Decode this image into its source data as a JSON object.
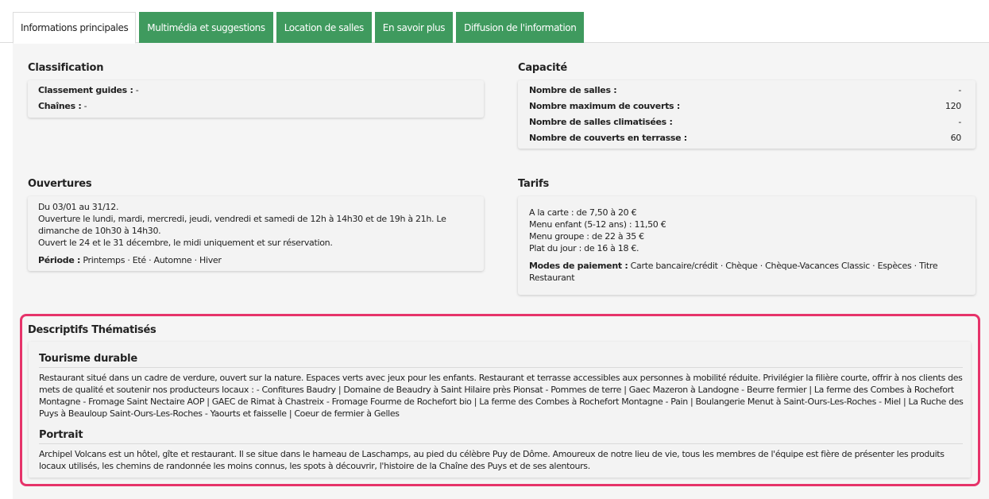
{
  "tabs": [
    {
      "label": "Informations principales",
      "active": true
    },
    {
      "label": "Multimédia et suggestions",
      "active": false
    },
    {
      "label": "Location de salles",
      "active": false
    },
    {
      "label": "En savoir plus",
      "active": false
    },
    {
      "label": "Diffusion de l'information",
      "active": false
    }
  ],
  "classification": {
    "title": "Classification",
    "rows": [
      {
        "label": "Classement guides :",
        "value": "-"
      },
      {
        "label": "Chaînes :",
        "value": "-"
      }
    ]
  },
  "capacite": {
    "title": "Capacité",
    "rows": [
      {
        "label": "Nombre de salles :",
        "value": "-"
      },
      {
        "label": "Nombre maximum de couverts :",
        "value": "120"
      },
      {
        "label": "Nombre de salles climatisées :",
        "value": "-"
      },
      {
        "label": "Nombre de couverts en terrasse :",
        "value": "60"
      }
    ]
  },
  "ouvertures": {
    "title": "Ouvertures",
    "lines": [
      "Du 03/01 au 31/12.",
      "Ouverture le lundi, mardi, mercredi, jeudi, vendredi et samedi de 12h à 14h30 et de 19h à 21h. Le dimanche de 10h30 à 14h30.",
      "Ouvert le 24 et le 31 décembre, le midi uniquement et sur réservation."
    ],
    "periode_label": "Période :",
    "periode": [
      "Printemps",
      "Eté",
      "Automne",
      "Hiver"
    ]
  },
  "tarifs": {
    "title": "Tarifs",
    "lines": [
      "A la carte : de 7,50 à 20 €",
      "Menu enfant (5-12 ans) : 11,50 €",
      "Menu groupe : de 22 à 35 €",
      "Plat du jour : de 16 à 18 €."
    ],
    "paiement_label": "Modes de paiement :",
    "paiement": [
      "Carte bancaire/crédit",
      "Chèque",
      "Chèque-Vacances Classic",
      "Espèces",
      "Titre Restaurant"
    ]
  },
  "descriptifs": {
    "title": "Descriptifs Thématisés",
    "sections": [
      {
        "title": "Tourisme durable",
        "text": "Restaurant situé dans un cadre de verdure, ouvert sur la nature. Espaces verts avec jeux pour les enfants. Restaurant et terrasse accessibles aux personnes à mobilité réduite. Privilégier la filière courte, offrir à nos clients des mets de qualité et soutenir nos producteurs locaux : - Confitures Baudry | Domaine de Beaudry à Saint Hilaire près Pionsat - Pommes de terre | Gaec Mazeron à Landogne - Beurre fermier | La ferme des Combes à Rochefort Montagne - Fromage Saint Nectaire AOP | GAEC de Rimat à Chastreix - Fromage Fourme de Rochefort bio | La ferme des Combes à Rochefort Montagne - Pain | Boulangerie Menut à Saint-Ours-Les-Roches - Miel | La Ruche des Puys à Beauloup Saint-Ours-Les-Roches - Yaourts et faisselle | Coeur de fermier à Gelles"
      },
      {
        "title": "Portrait",
        "text": "Archipel Volcans est un hôtel, gîte et restaurant. Il se situe dans le hameau de Laschamps, au pied du célèbre Puy de Dôme. Amoureux de notre lieu de vie, tous les membres de l'équipe est fière de présenter les produits locaux utilisés, les chemins de randonnée les moins connus, les spots à découvrir, l'histoire de la Chaîne des Puys et de ses alentours."
      }
    ]
  },
  "colors": {
    "tab_green": "#3f9a5e",
    "highlight_border": "#e6336a"
  }
}
